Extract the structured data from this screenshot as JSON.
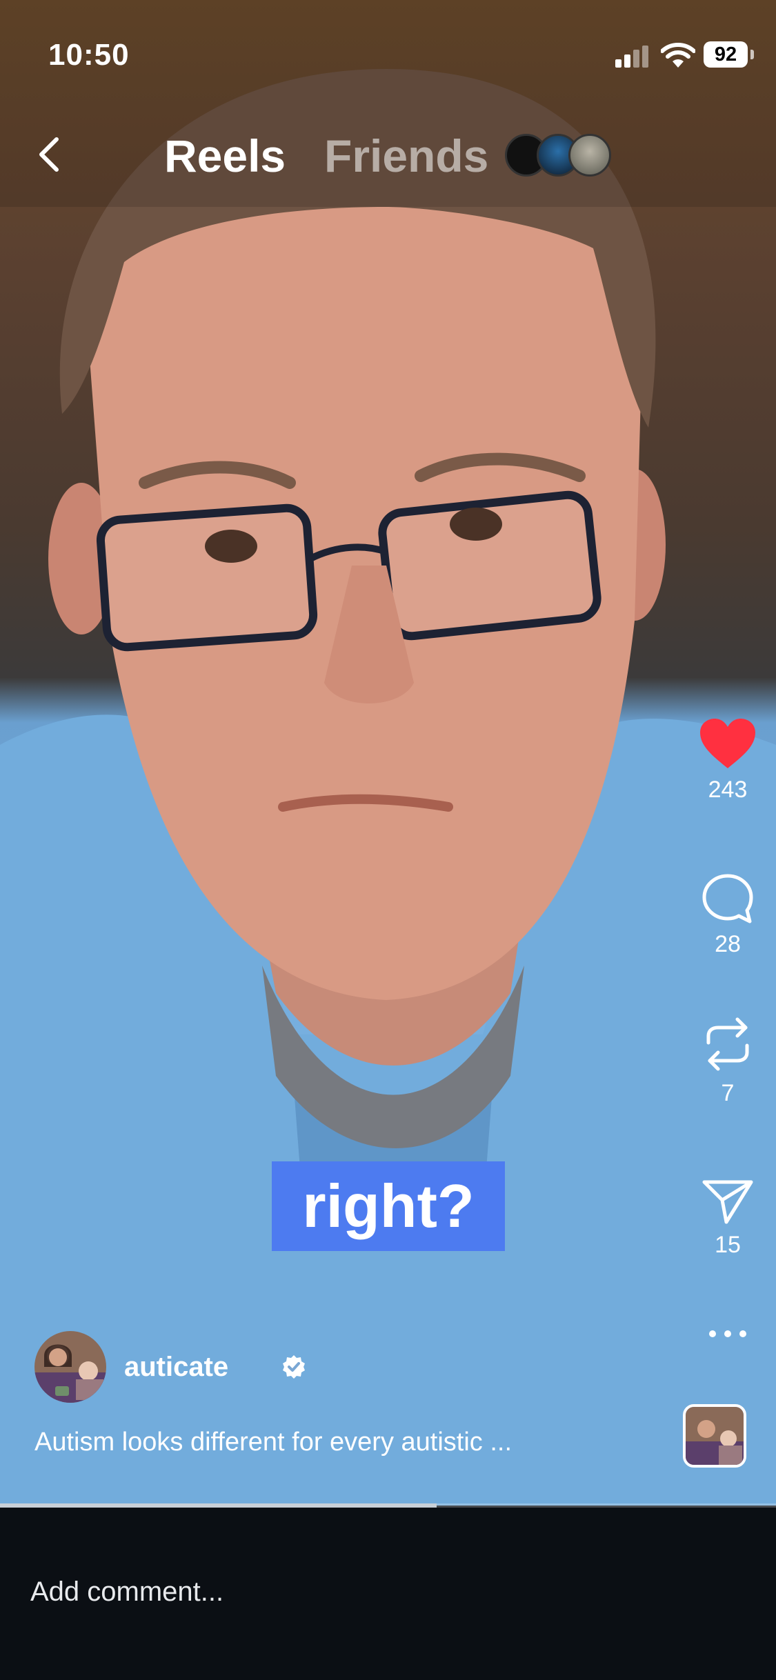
{
  "status_bar": {
    "time": "10:50",
    "battery": "92"
  },
  "nav": {
    "tab_reels": "Reels",
    "tab_friends": "Friends"
  },
  "caption": {
    "word": "right?"
  },
  "actions": {
    "likes": "243",
    "comments": "28",
    "reposts": "7",
    "shares": "15"
  },
  "post": {
    "author": "auticate",
    "description": "Autism looks different for every autistic ..."
  },
  "playback": {
    "progress": 0.563
  },
  "comment": {
    "placeholder": "Add comment..."
  },
  "colors": {
    "like": "#ff3040",
    "caption_bg": "#4d7bf0"
  },
  "icons": [
    "back-chevron-icon",
    "heart-icon",
    "comment-icon",
    "repost-icon",
    "share-icon",
    "more-icon",
    "verified-badge-icon"
  ]
}
